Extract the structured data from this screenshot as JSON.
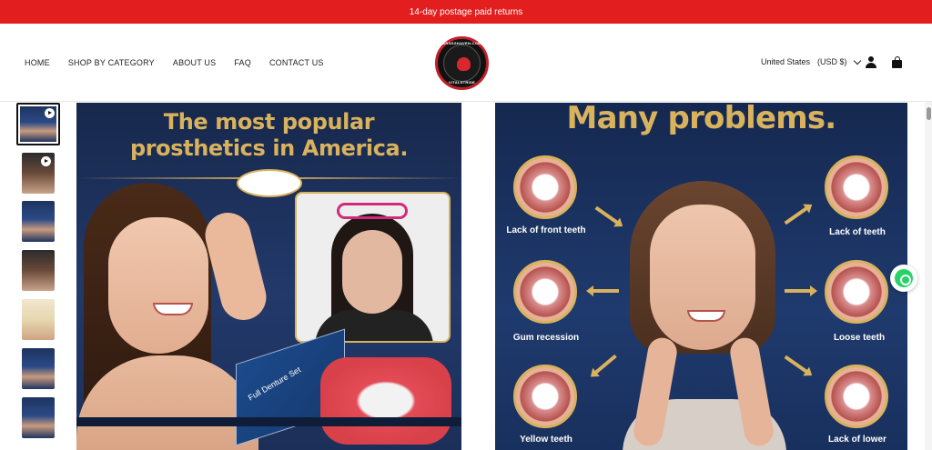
{
  "announcement": {
    "text": "14-day postage paid returns"
  },
  "nav": {
    "items": [
      {
        "label": "HOME"
      },
      {
        "label": "SHOP BY CATEGORY"
      },
      {
        "label": "ABOUT US"
      },
      {
        "label": "FAQ"
      },
      {
        "label": "CONTACT US"
      }
    ]
  },
  "logo": {
    "top_text": "ARSSGHAVEN.COM",
    "bottom_text": "VITALSTRIDE"
  },
  "locale": {
    "country": "United States",
    "currency": "(USD $)"
  },
  "icons": {
    "account": "account-icon",
    "cart": "cart-icon",
    "whatsapp": "whatsapp-icon",
    "play": "play-icon",
    "chevron": "chevron-down-icon"
  },
  "colors": {
    "announcement_bg": "#e21e1e",
    "gold": "#d9b25d",
    "navy": "#1f3a6e",
    "whatsapp": "#25d366"
  },
  "gallery": {
    "media1": {
      "headline": [
        "The most popular",
        "prosthetics in America."
      ],
      "box_label": "Full Denture Set"
    },
    "media2": {
      "headline": "Many problems.",
      "labels": {
        "lack_front": "Lack of front teeth",
        "lack_teeth": "Lack of teeth",
        "gum": "Gum recession",
        "loose": "Loose teeth",
        "yellow": "Yellow teeth",
        "lack_lower": "Lack of lower"
      }
    }
  }
}
